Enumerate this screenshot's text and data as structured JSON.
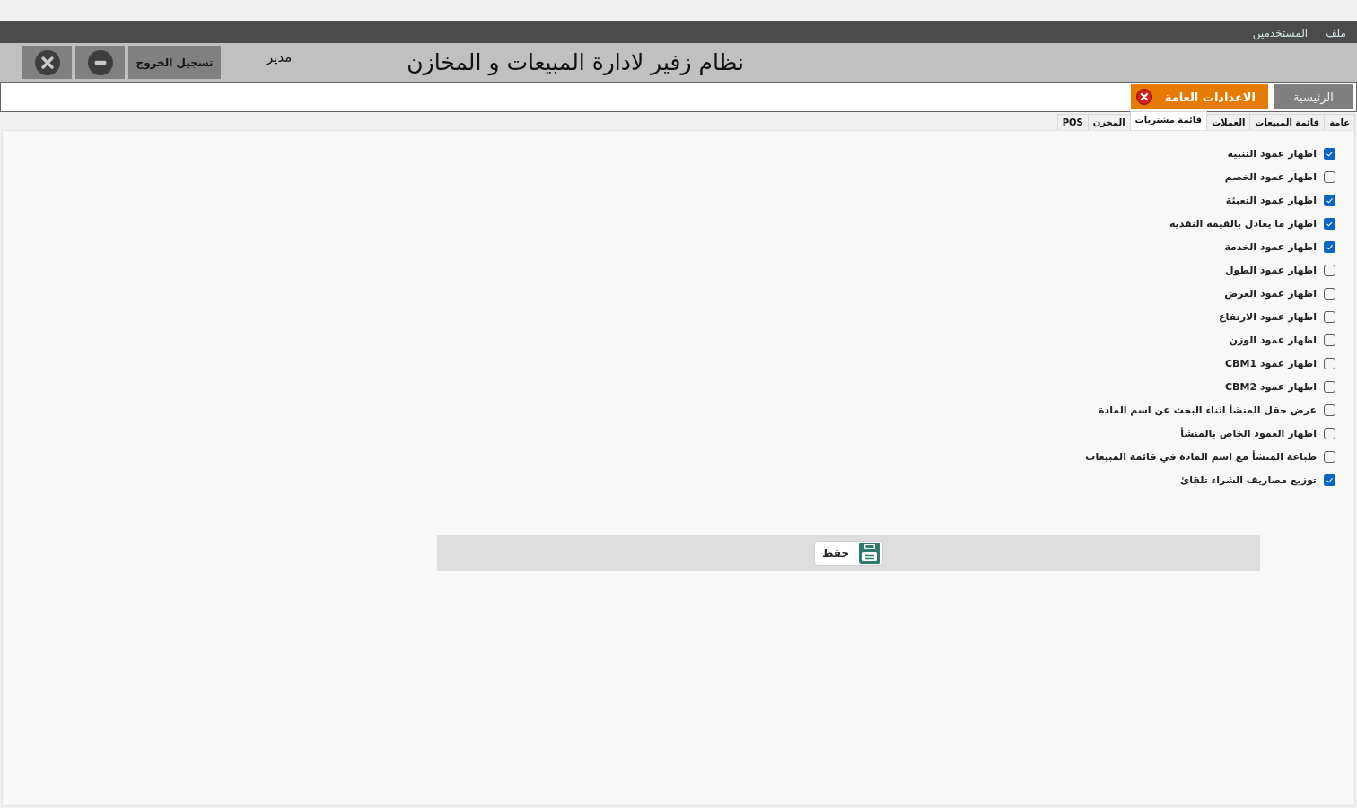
{
  "menu_bar": {
    "items": [
      "ملف",
      "المستخدمين"
    ]
  },
  "header": {
    "title": "نظام زفير لادارة المبيعات و المخازن",
    "user_role": "مدير",
    "logout_button": "تسجيل الخروج"
  },
  "main_tabs": [
    {
      "label": "الرئيسية",
      "selected": false,
      "closable": false
    },
    {
      "label": "الاعدادات العامة",
      "selected": true,
      "closable": true
    }
  ],
  "settings_tabs": [
    {
      "label": "عامة",
      "selected": false
    },
    {
      "label": "قائمة المبيعات",
      "selected": false
    },
    {
      "label": "العملات",
      "selected": false
    },
    {
      "label": "قائمة مشتريات",
      "selected": true
    },
    {
      "label": "المخزن",
      "selected": false
    },
    {
      "label": "POS",
      "selected": false
    }
  ],
  "options": [
    {
      "label": "اظهار عمود التنبيه",
      "checked": true
    },
    {
      "label": "اظهار عمود الخصم",
      "checked": false
    },
    {
      "label": "اظهار عمود التعبئة",
      "checked": true
    },
    {
      "label": "اظهار ما يعادل بالقيمة النقدية",
      "checked": true
    },
    {
      "label": "اظهار عمود الخدمة",
      "checked": true
    },
    {
      "label": "اظهار عمود الطول",
      "checked": false
    },
    {
      "label": "اظهار عمود العرض",
      "checked": false
    },
    {
      "label": "اظهار عمود الارتفاع",
      "checked": false
    },
    {
      "label": "اظهار عمود الوزن",
      "checked": false
    },
    {
      "label": "اظهار عمود CBM1",
      "checked": false
    },
    {
      "label": "اظهار عمود CBM2",
      "checked": false
    },
    {
      "label": "عرض حقل المنشأ اثناء البحث عن اسم المادة",
      "checked": false
    },
    {
      "label": "اظهار العمود الخاص بالمنشأ",
      "checked": false
    },
    {
      "label": "طباعة المنشأ مع اسم المادة في قائمة المبيعات",
      "checked": false
    },
    {
      "label": "توزيع مصاريف الشراء تلقائ",
      "checked": true
    }
  ],
  "save_button": {
    "label": "حفظ"
  }
}
